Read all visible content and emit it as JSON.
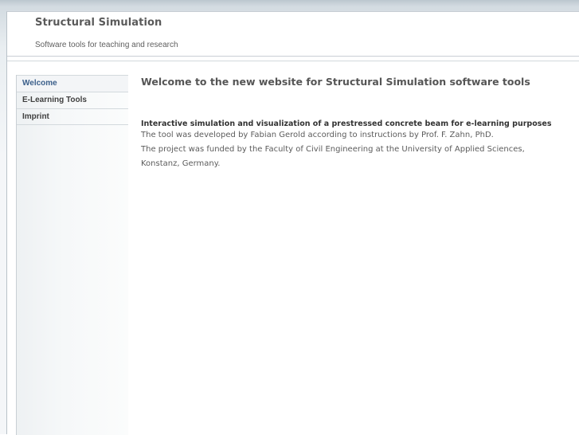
{
  "header": {
    "title": "Structural Simulation",
    "tagline": "Software tools for teaching and research"
  },
  "sidebar": {
    "items": [
      {
        "label": "Welcome",
        "active": true
      },
      {
        "label": "E-Learning Tools",
        "active": false
      },
      {
        "label": "Imprint",
        "active": false
      }
    ]
  },
  "main": {
    "heading": "Welcome to the new website for Structural Simulation software tools",
    "project_title": "Interactive simulation and visualization of a prestressed concrete beam for e-learning purposes",
    "line1": "The tool was developed by Fabian Gerold according to instructions by Prof. F. Zahn, PhD.",
    "line2": "The project was funded by the Faculty of Civil Engineering at the University of Applied Sciences,",
    "line3": "Konstanz, Germany."
  },
  "colors": {
    "accent_nav_active": "#3b5f8a",
    "heading": "#555555",
    "text": "#5c5c5c"
  }
}
